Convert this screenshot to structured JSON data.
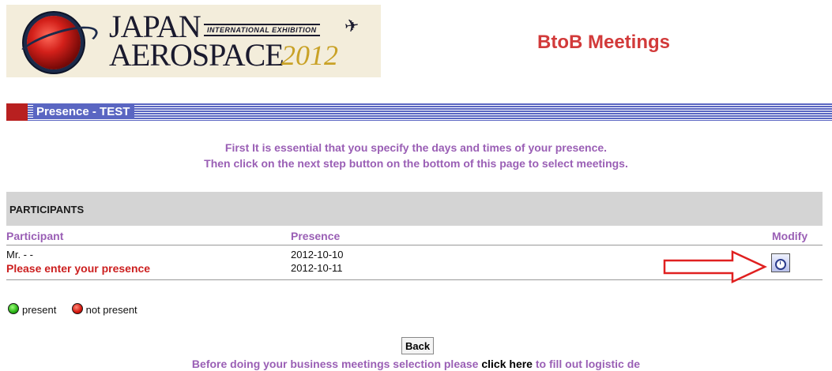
{
  "logo": {
    "japan": "JAPAN",
    "tagline": "INTERNATIONAL EXHIBITION",
    "aerospace": "AEROSPACE",
    "year": "2012"
  },
  "page_heading": "BtoB Meetings",
  "section": {
    "title": "Presence - TEST"
  },
  "intro": {
    "line1": "First It is essential that you specify the days and times of your presence.",
    "line2": "Then click on the next step button on the bottom of this page to select meetings."
  },
  "participants": {
    "header": "PARTICIPANTS",
    "columns": {
      "participant": "Participant",
      "presence": "Presence",
      "modify": "Modify"
    },
    "rows": [
      {
        "name": "Mr. - -",
        "warning": "Please enter your presence",
        "dates": [
          "2012-10-10",
          "2012-10-11"
        ]
      }
    ]
  },
  "legend": {
    "present": "present",
    "not_present": "not present"
  },
  "back_label": "Back",
  "footer": {
    "before": "Before doing your business meetings selection please ",
    "link": "click here",
    "after": " to fill out logistic de"
  },
  "colors": {
    "heading": "#d23a3a",
    "accent_text": "#9a5fb5",
    "section_bar": "#5a66c2",
    "warning": "#cc1f1f"
  },
  "icons": [
    "globe-logo-icon",
    "airplane-icon",
    "arrow-right-icon",
    "clock-icon",
    "green-dot-icon",
    "red-dot-icon"
  ]
}
